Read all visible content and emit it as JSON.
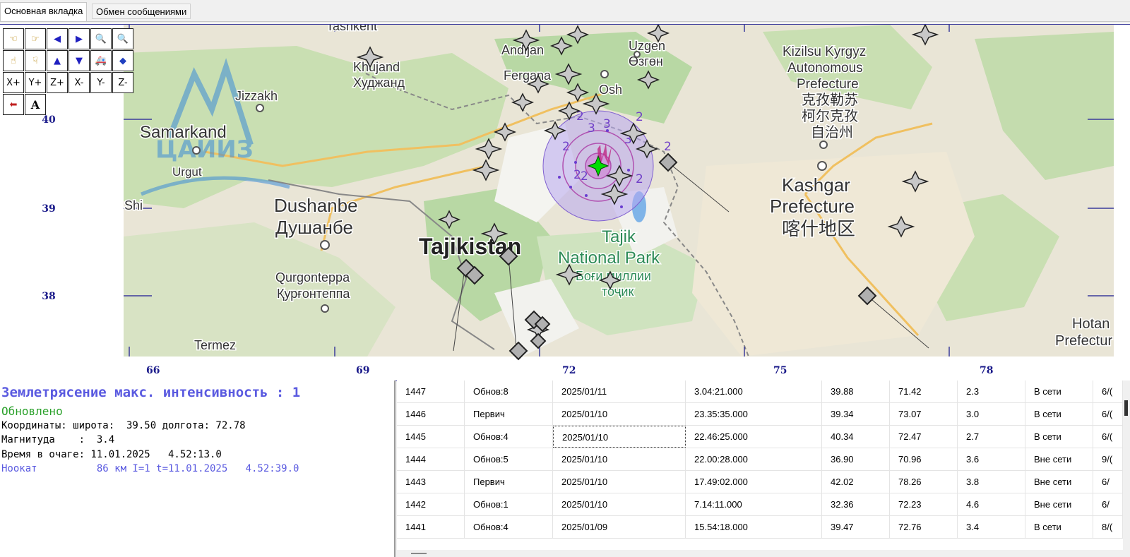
{
  "tabs": [
    {
      "label": "Основная вкладка",
      "active": true
    },
    {
      "label": "Обмен сообщениями",
      "active": false
    }
  ],
  "map": {
    "lat_labels": [
      "40",
      "39",
      "38"
    ],
    "lon_labels": [
      "66",
      "69",
      "72",
      "75",
      "78"
    ],
    "watermark_text": "ЦАИИЗ",
    "place_labels": [
      "Tashkent",
      "Andijan",
      "Uzgen",
      "Өзгөн",
      "Khujand",
      "Худжанд",
      "Fergana",
      "Osh",
      "Jizzakh",
      "Samarkand",
      "Urgut",
      "Kizilsu Kyrgyz",
      "Autonomous",
      "Prefecture",
      "克孜勒苏",
      "柯尔克孜",
      "自治州",
      "Kashgar",
      "Prefecture",
      "喀什地区",
      "Dushanbe",
      "Душанбе",
      "Tajikistan",
      "Tajik",
      "National Park",
      "Боғи миллии",
      "тоҷик",
      "Qurgonteppa",
      "Қурғонтеппа",
      "Termez",
      "Hotan",
      "Prefectur",
      "Shi"
    ],
    "intensity_labels": [
      "2",
      "3",
      "3",
      "2",
      "2",
      "2",
      "3",
      "2",
      "2",
      "2"
    ],
    "colors": {
      "epicenter": "#00dd00",
      "zone_outer": "#b8a8f0",
      "zone_inner": "#d070d0",
      "station": "#c8c8c8"
    }
  },
  "toolbar": {
    "buttons": [
      {
        "name": "pan-left-hand-icon",
        "label": "☜"
      },
      {
        "name": "pan-right-hand-icon",
        "label": "☞"
      },
      {
        "name": "arrow-left-icon",
        "label": "◀"
      },
      {
        "name": "arrow-right-icon",
        "label": "▶"
      },
      {
        "name": "zoom-out-icon",
        "label": "🔍"
      },
      {
        "name": "zoom-in-icon",
        "label": "🔍"
      },
      {
        "name": "hand-up-icon",
        "label": "☝"
      },
      {
        "name": "hand-down-icon",
        "label": "☟"
      },
      {
        "name": "arrow-up-icon",
        "label": "▲"
      },
      {
        "name": "arrow-down-icon",
        "label": "▼"
      },
      {
        "name": "vehicle-icon",
        "label": "🚑"
      },
      {
        "name": "eraser-icon",
        "label": "◆"
      },
      {
        "name": "x-plus-button",
        "label": "X+"
      },
      {
        "name": "y-plus-button",
        "label": "Y+"
      },
      {
        "name": "z-plus-button",
        "label": "Z+"
      },
      {
        "name": "x-minus-button",
        "label": "X-"
      },
      {
        "name": "y-minus-button",
        "label": "Y-"
      },
      {
        "name": "z-minus-button",
        "label": "Z-"
      },
      {
        "name": "back-arrow-icon",
        "label": "⬅"
      },
      {
        "name": "text-tool-icon",
        "label": "A"
      }
    ]
  },
  "event_info": {
    "title": "Землетрясение макс. интенсивность : 1",
    "status": "Обновлено",
    "coords": "Координаты: широта:  39.50 долгота: 72.78",
    "magnitude": "Магнитуда    :  3.4",
    "time": "Время в очаге: 11.01.2025   4.52:13.0",
    "station": "Ноокат          86 км I=1 t=11.01.2025   4.52:39.0"
  },
  "table": {
    "rows": [
      {
        "id": "1447",
        "type": "Обнов:8",
        "date": "2025/01/11",
        "time": "3.04:21.000",
        "lat": "39.88",
        "lon": "71.42",
        "mag": "2.3",
        "net": "В сети",
        "extra": "6/("
      },
      {
        "id": "1446",
        "type": "Первич",
        "date": "2025/01/10",
        "time": "23.35:35.000",
        "lat": "39.34",
        "lon": "73.07",
        "mag": "3.0",
        "net": "В сети",
        "extra": "6/("
      },
      {
        "id": "1445",
        "type": "Обнов:4",
        "date": "2025/01/10",
        "time": "22.46:25.000",
        "lat": "40.34",
        "lon": "72.47",
        "mag": "2.7",
        "net": "В сети",
        "extra": "6/("
      },
      {
        "id": "1444",
        "type": "Обнов:5",
        "date": "2025/01/10",
        "time": "22.00:28.000",
        "lat": "36.90",
        "lon": "70.96",
        "mag": "3.6",
        "net": "Вне сети",
        "extra": "9/("
      },
      {
        "id": "1443",
        "type": "Первич",
        "date": "2025/01/10",
        "time": "17.49:02.000",
        "lat": "42.02",
        "lon": "78.26",
        "mag": "3.8",
        "net": "Вне сети",
        "extra": "6/"
      },
      {
        "id": "1442",
        "type": "Обнов:1",
        "date": "2025/01/10",
        "time": "7.14:11.000",
        "lat": "32.36",
        "lon": "72.23",
        "mag": "4.6",
        "net": "Вне сети",
        "extra": "6/"
      },
      {
        "id": "1441",
        "type": "Обнов:4",
        "date": "2025/01/09",
        "time": "15.54:18.000",
        "lat": "39.47",
        "lon": "72.76",
        "mag": "3.4",
        "net": "В сети",
        "extra": "8/("
      }
    ]
  }
}
